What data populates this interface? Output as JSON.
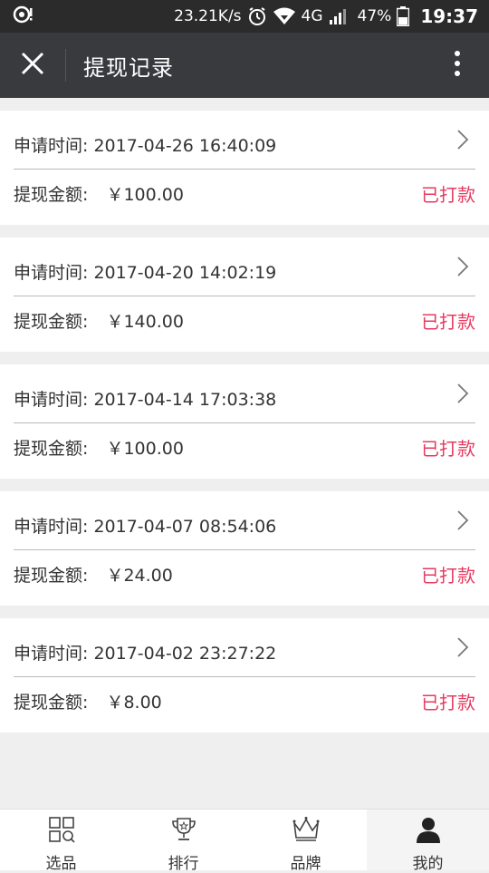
{
  "status_bar": {
    "network_speed": "23.21K/s",
    "network_type": "4G",
    "battery": "47%",
    "time": "19:37"
  },
  "header": {
    "title": "提现记录"
  },
  "records": [
    {
      "time_label": "申请时间:",
      "time": "2017-04-26 16:40:09",
      "amount_label": "提现金额:",
      "amount": "￥100.00",
      "status": "已打款"
    },
    {
      "time_label": "申请时间:",
      "time": "2017-04-20 14:02:19",
      "amount_label": "提现金额:",
      "amount": "￥140.00",
      "status": "已打款"
    },
    {
      "time_label": "申请时间:",
      "time": "2017-04-14 17:03:38",
      "amount_label": "提现金额:",
      "amount": "￥100.00",
      "status": "已打款"
    },
    {
      "time_label": "申请时间:",
      "time": "2017-04-07 08:54:06",
      "amount_label": "提现金额:",
      "amount": "￥24.00",
      "status": "已打款"
    },
    {
      "time_label": "申请时间:",
      "time": "2017-04-02 23:27:22",
      "amount_label": "提现金额:",
      "amount": "￥8.00",
      "status": "已打款"
    }
  ],
  "tabs": [
    {
      "label": "选品",
      "icon": "grid-search-icon"
    },
    {
      "label": "排行",
      "icon": "trophy-icon"
    },
    {
      "label": "品牌",
      "icon": "crown-icon"
    },
    {
      "label": "我的",
      "icon": "user-icon",
      "active": true
    }
  ],
  "colors": {
    "status_paid": "#e73a60",
    "nav_background": "#393a3e",
    "status_bar_background": "#2b2b2b"
  }
}
